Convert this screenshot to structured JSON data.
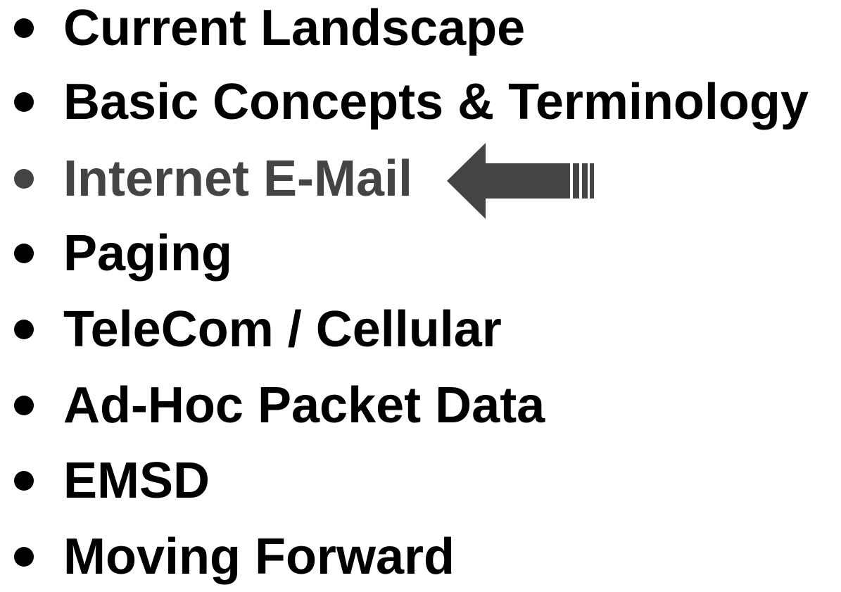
{
  "agenda": {
    "items": [
      {
        "label": "Current Landscape",
        "current": false
      },
      {
        "label": "Basic Concepts & Terminology",
        "current": false
      },
      {
        "label": "Internet E-Mail",
        "current": true
      },
      {
        "label": "Paging",
        "current": false
      },
      {
        "label": "TeleCom / Cellular",
        "current": false
      },
      {
        "label": "Ad-Hoc Packet Data",
        "current": false
      },
      {
        "label": "EMSD",
        "current": false
      },
      {
        "label": "Moving Forward",
        "current": false
      }
    ],
    "colors": {
      "text": "#000000",
      "current_text": "#444444",
      "arrow": "#444444"
    },
    "current_marker_icon": "left-arrow-icon"
  }
}
